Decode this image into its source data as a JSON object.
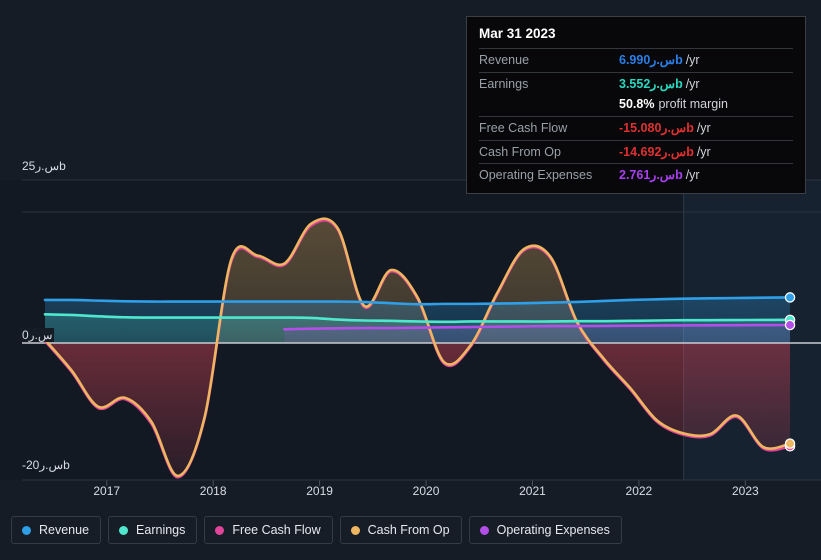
{
  "background": "#151c25",
  "tooltip": {
    "date": "Mar 31 2023",
    "unit_suffix": "/yr",
    "rows": [
      {
        "label": "Revenue",
        "value": "6.990س.رb",
        "unit": "/yr",
        "color": "#2a7fe8"
      },
      {
        "label": "Earnings",
        "value": "3.552س.رb",
        "unit": "/yr",
        "color": "#2bd8c0"
      },
      {
        "label": "",
        "value": "50.8%",
        "unit": "profit margin",
        "color": "#ffffff"
      },
      {
        "label": "Free Cash Flow",
        "value": "-15.080س.رb",
        "unit": "/yr",
        "color": "#e03030"
      },
      {
        "label": "Cash From Op",
        "value": "-14.692س.رb",
        "unit": "/yr",
        "color": "#e03030"
      },
      {
        "label": "Operating Expenses",
        "value": "2.761س.رb",
        "unit": "/yr",
        "color": "#a83ff0"
      }
    ]
  },
  "axes": {
    "y_top": "25س.رb",
    "y_zero": "0س.ر",
    "y_bottom": "-20س.رb",
    "y_max": 25,
    "y_min": -20,
    "x_ticks": [
      "2017",
      "2018",
      "2019",
      "2020",
      "2021",
      "2022",
      "2023"
    ]
  },
  "legend": [
    {
      "label": "Revenue",
      "color": "#2f9fe8"
    },
    {
      "label": "Earnings",
      "color": "#4fe8cf"
    },
    {
      "label": "Free Cash Flow",
      "color": "#e0459a"
    },
    {
      "label": "Cash From Op",
      "color": "#efb662"
    },
    {
      "label": "Operating Expenses",
      "color": "#b24fe8"
    }
  ],
  "chart_data": {
    "type": "area",
    "title": "",
    "xlabel": "",
    "ylabel": "س.ر (billions)",
    "ylim": [
      -20,
      25
    ],
    "xlim": [
      2016.45,
      2023.6
    ],
    "grid": true,
    "legend_position": "bottom",
    "forecast_region_start": 2022.45,
    "x": [
      2016.45,
      2016.7,
      2016.95,
      2017.2,
      2017.45,
      2017.7,
      2017.95,
      2018.2,
      2018.45,
      2018.7,
      2018.95,
      2019.2,
      2019.45,
      2019.7,
      2019.95,
      2020.2,
      2020.45,
      2020.7,
      2020.95,
      2021.2,
      2021.45,
      2021.7,
      2021.95,
      2022.2,
      2022.45,
      2022.7,
      2022.95,
      2023.2,
      2023.45
    ],
    "series": [
      {
        "name": "Revenue",
        "color": "#2f9fe8",
        "values": [
          6.6,
          6.6,
          6.5,
          6.4,
          6.35,
          6.35,
          6.35,
          6.35,
          6.35,
          6.35,
          6.35,
          6.35,
          6.3,
          6.1,
          5.95,
          6.0,
          6.0,
          6.05,
          6.1,
          6.2,
          6.3,
          6.45,
          6.6,
          6.7,
          6.8,
          6.85,
          6.9,
          6.95,
          6.99
        ]
      },
      {
        "name": "Earnings",
        "color": "#4fe8cf",
        "values": [
          4.4,
          4.3,
          4.1,
          3.95,
          3.9,
          3.9,
          3.9,
          3.9,
          3.9,
          3.9,
          3.85,
          3.6,
          3.45,
          3.4,
          3.3,
          3.25,
          3.3,
          3.3,
          3.3,
          3.3,
          3.35,
          3.35,
          3.4,
          3.45,
          3.5,
          3.5,
          3.52,
          3.54,
          3.55
        ]
      },
      {
        "name": "Free Cash Flow",
        "color": "#e0459a",
        "values": [
          0.3,
          -4.2,
          -9.5,
          -8.2,
          -11.8,
          -19.6,
          -11.0,
          12.5,
          13.2,
          12.0,
          18.0,
          17.4,
          5.5,
          11.0,
          6.8,
          -3.0,
          -0.5,
          7.5,
          14.2,
          13.0,
          3.0,
          -2.5,
          -6.8,
          -11.5,
          -13.4,
          -13.5,
          -10.8,
          -15.4,
          -15.08
        ]
      },
      {
        "name": "Cash From Op",
        "color": "#efb662",
        "values": [
          0.5,
          -4.0,
          -9.3,
          -8.0,
          -11.5,
          -19.4,
          -10.8,
          12.8,
          13.4,
          12.2,
          18.3,
          17.6,
          5.7,
          11.2,
          7.0,
          -2.8,
          -0.3,
          7.7,
          14.4,
          13.2,
          3.2,
          -2.3,
          -6.6,
          -11.3,
          -13.2,
          -13.3,
          -10.6,
          -15.2,
          -14.69
        ]
      },
      {
        "name": "Operating Expenses",
        "color": "#b24fe8",
        "values": [
          null,
          null,
          null,
          null,
          null,
          null,
          null,
          null,
          null,
          2.1,
          2.2,
          2.25,
          2.3,
          2.3,
          2.35,
          2.4,
          2.45,
          2.5,
          2.55,
          2.6,
          2.6,
          2.62,
          2.65,
          2.68,
          2.7,
          2.72,
          2.74,
          2.75,
          2.76
        ]
      }
    ]
  }
}
